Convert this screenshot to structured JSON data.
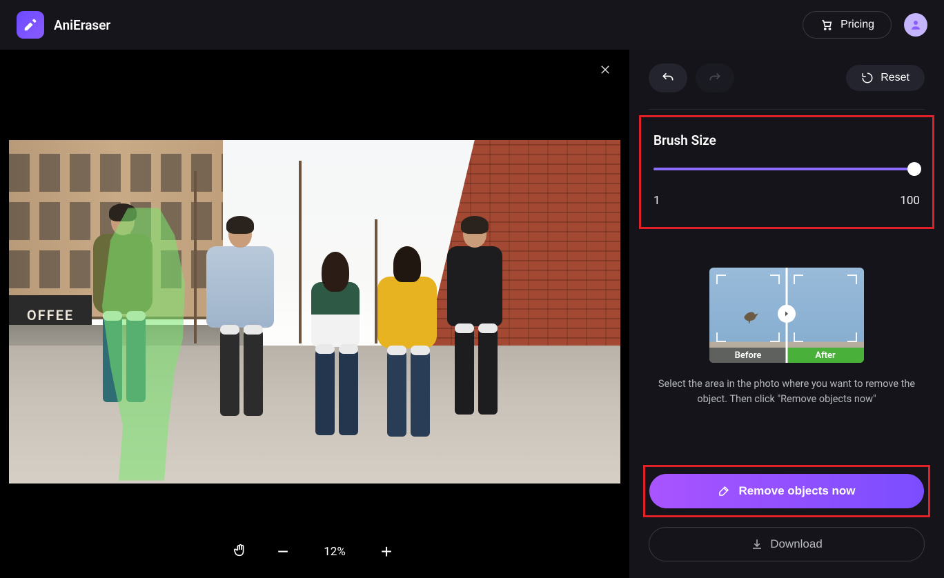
{
  "header": {
    "brand": "AniEraser",
    "pricing": "Pricing"
  },
  "canvas": {
    "sign_text": "OFFEE",
    "zoom": "12%"
  },
  "sidebar": {
    "reset": "Reset",
    "brush_label": "Brush Size",
    "brush_min": "1",
    "brush_max": "100",
    "before": "Before",
    "after": "After",
    "help": "Select the area in the photo where you want to remove the object. Then click \"Remove objects now\"",
    "remove": "Remove objects now",
    "download": "Download"
  }
}
